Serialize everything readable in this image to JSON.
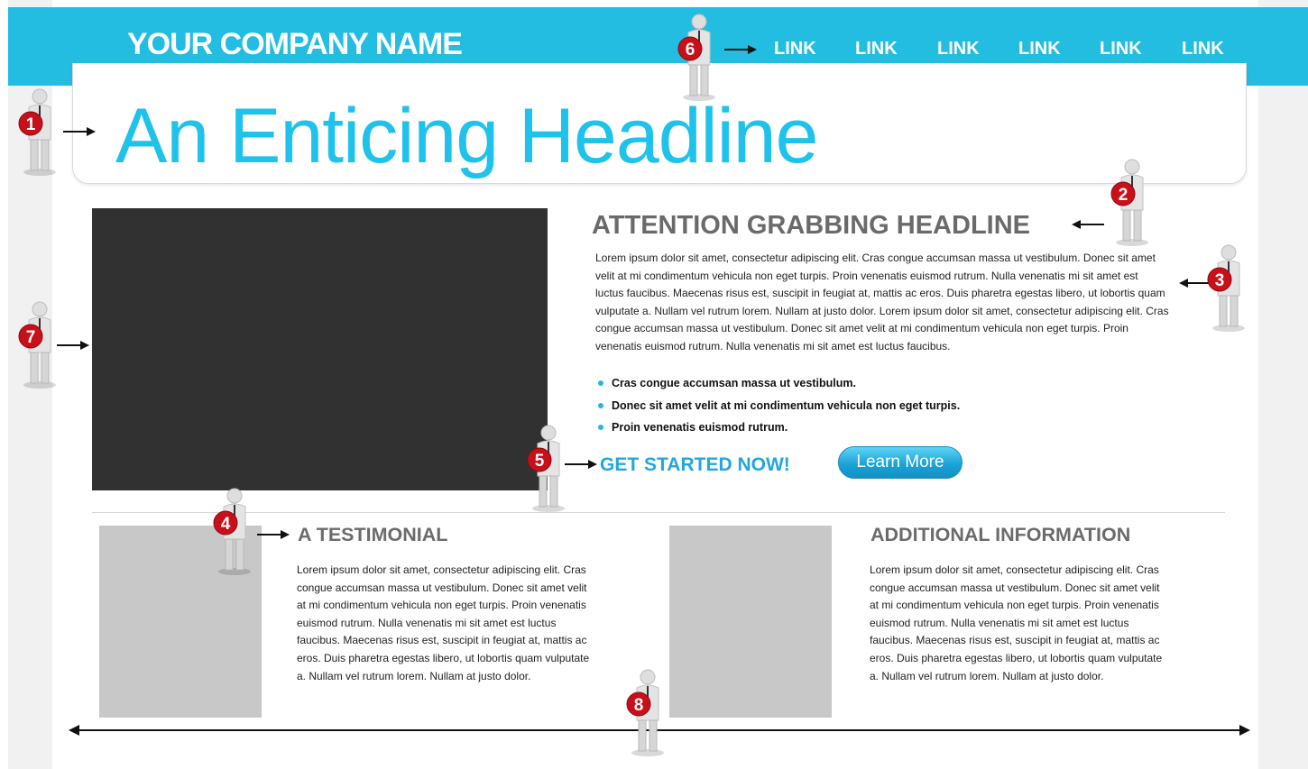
{
  "header": {
    "company_name": "YOUR COMPANY NAME",
    "nav_links": [
      "LINK",
      "LINK",
      "LINK",
      "LINK",
      "LINK",
      "LINK"
    ]
  },
  "hero": {
    "headline": "An Enticing Headline"
  },
  "feature": {
    "headline": "ATTENTION GRABBING HEADLINE",
    "body": "Lorem ipsum dolor sit amet, consectetur adipiscing elit. Cras congue accumsan massa ut vestibulum. Donec sit amet velit at mi condimentum vehicula non eget turpis. Proin venenatis euismod rutrum. Nulla venenatis mi sit amet est luctus faucibus. Maecenas risus est, suscipit in feugiat at, mattis ac eros. Duis pharetra egestas libero, ut lobortis quam vulputate a. Nullam vel rutrum lorem. Nullam at justo dolor. Lorem ipsum dolor sit amet, consectetur adipiscing elit. Cras congue accumsan massa ut vestibulum. Donec sit amet velit at mi condimentum vehicula non eget turpis. Proin venenatis euismod rutrum. Nulla venenatis mi sit amet est luctus faucibus.",
    "bullets": [
      "Cras congue accumsan massa ut vestibulum.",
      "Donec sit amet velit at mi condimentum vehicula non eget turpis.",
      "Proin venenatis euismod rutrum."
    ],
    "cta_text": "GET STARTED NOW!",
    "learn_more": "Learn More"
  },
  "testimonial": {
    "headline": "A TESTIMONIAL",
    "body": "Lorem ipsum dolor sit amet, consectetur adipiscing elit. Cras congue accumsan massa ut vestibulum. Donec sit amet velit at mi condimentum vehicula non eget turpis. Proin venenatis euismod rutrum. Nulla venenatis mi sit amet est luctus faucibus. Maecenas risus est, suscipit in feugiat at, mattis ac eros. Duis pharetra egestas libero, ut lobortis quam vulputate a. Nullam vel rutrum lorem. Nullam at justo dolor."
  },
  "additional": {
    "headline": "ADDITIONAL INFORMATION",
    "body": "Lorem ipsum dolor sit amet, consectetur adipiscing elit. Cras congue accumsan massa ut vestibulum. Donec sit amet velit at mi condimentum vehicula non eget turpis. Proin venenatis euismod rutrum. Nulla venenatis mi sit amet est luctus faucibus. Maecenas risus est, suscipit in feugiat at, mattis ac eros. Duis pharetra egestas libero, ut lobortis quam vulputate a. Nullam vel rutrum lorem. Nullam at justo dolor."
  },
  "markers": [
    "1",
    "2",
    "3",
    "4",
    "5",
    "6",
    "7",
    "8"
  ],
  "colors": {
    "accent": "#22bde1",
    "headline": "#1fc2ea",
    "marker_red": "#c8101a",
    "video_bg": "#313131",
    "placeholder": "#c8c8c8"
  },
  "icons": [
    "annotation-person-icon",
    "arrow-right-icon",
    "arrow-left-icon",
    "double-arrow-icon"
  ]
}
